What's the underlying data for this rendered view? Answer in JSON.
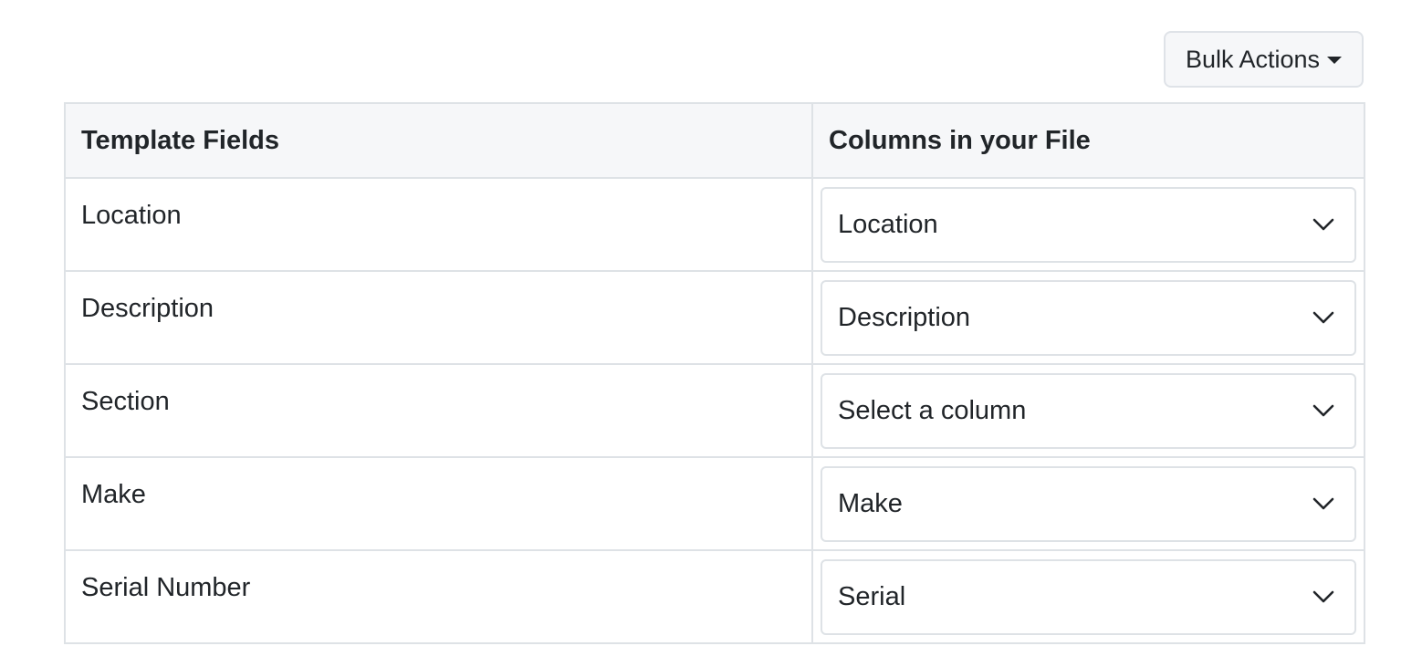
{
  "toolbar": {
    "bulk_actions_label": "Bulk Actions"
  },
  "table": {
    "headers": [
      "Template Fields",
      "Columns in your File"
    ],
    "rows": [
      {
        "field": "Location",
        "column": "Location"
      },
      {
        "field": "Description",
        "column": "Description"
      },
      {
        "field": "Section",
        "column": "Select a column"
      },
      {
        "field": "Make",
        "column": "Make"
      },
      {
        "field": "Serial Number",
        "column": "Serial"
      }
    ]
  }
}
